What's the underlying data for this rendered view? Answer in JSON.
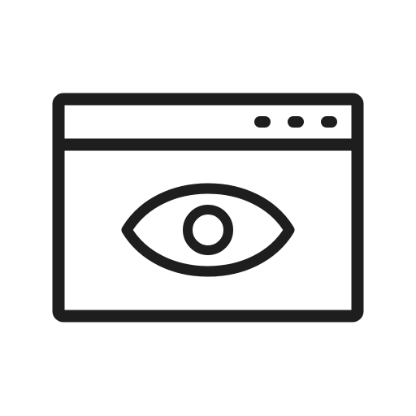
{
  "icon": {
    "name": "browser-window-eye-icon",
    "color": "#1e1e1e",
    "background": "#ffffff",
    "parts": {
      "window": "browser-window-frame",
      "title_bar": "title-bar",
      "window_dots": [
        "window-dot",
        "window-dot",
        "window-dot"
      ],
      "eye": "eye-icon",
      "pupil": "pupil"
    }
  }
}
